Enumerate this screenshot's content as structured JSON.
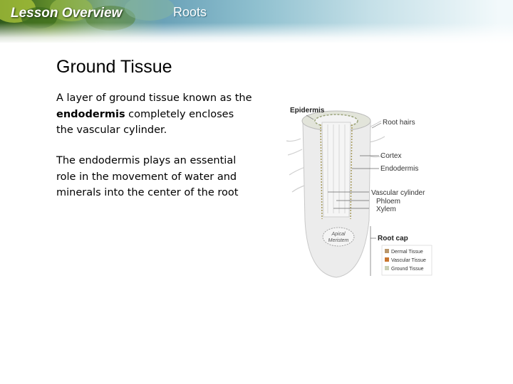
{
  "header": {
    "lesson_label": "Lesson Overview",
    "topic": "Roots"
  },
  "slide": {
    "title": "Ground Tissue",
    "paragraph1": {
      "before": "A layer of ground tissue known as the ",
      "bold": "endodermis",
      "after": " completely encloses the vascular cylinder."
    },
    "paragraph2": "The endodermis plays an essential role in the movement of water and minerals into the center of the root"
  },
  "diagram": {
    "labels": {
      "epidermis": "Epidermis",
      "root_hairs": "Root hairs",
      "cortex": "Cortex",
      "endodermis": "Endodermis",
      "vascular_cylinder": "Vascular cylinder",
      "phloem": "Phloem",
      "xylem": "Xylem",
      "apical_meristem_line1": "Apical",
      "apical_meristem_line2": "Meristem",
      "root_cap": "Root cap"
    },
    "legend": [
      {
        "label": "Dermal Tissue",
        "color": "#b9966a"
      },
      {
        "label": "Vascular Tissue",
        "color": "#c9762e"
      },
      {
        "label": "Ground Tissue",
        "color": "#c9cfb4"
      }
    ]
  }
}
